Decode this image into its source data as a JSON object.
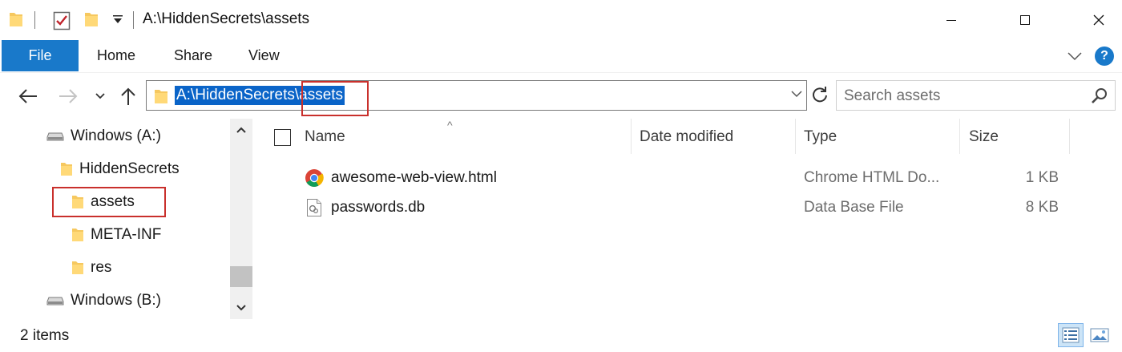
{
  "window": {
    "title": "A:\\HiddenSecrets\\assets",
    "minimize_glyph": "—",
    "maximize_glyph": "☐",
    "close_glyph": "✕"
  },
  "ribbon": {
    "file_label": "File",
    "tabs": [
      "Home",
      "Share",
      "View"
    ],
    "help_glyph": "?"
  },
  "address": {
    "path_prefix": "A:\\HiddenSecrets",
    "path_sep": "\\",
    "path_current": "assets"
  },
  "search": {
    "placeholder": "Search assets"
  },
  "nav_pane": {
    "items": [
      {
        "label": "Windows (A:)",
        "icon": "drive-icon"
      },
      {
        "label": "HiddenSecrets",
        "icon": "folder-icon"
      },
      {
        "label": "assets",
        "icon": "folder-icon"
      },
      {
        "label": "META-INF",
        "icon": "folder-icon"
      },
      {
        "label": "res",
        "icon": "folder-icon"
      },
      {
        "label": "Windows (B:)",
        "icon": "drive-icon"
      }
    ]
  },
  "file_list": {
    "columns": {
      "name": "Name",
      "date_modified": "Date modified",
      "type": "Type",
      "size": "Size"
    },
    "sort_indicator": "^",
    "files": [
      {
        "name": "awesome-web-view.html",
        "date_modified": "",
        "type": "Chrome HTML Do...",
        "size": "1 KB",
        "icon": "chrome-icon"
      },
      {
        "name": "passwords.db",
        "date_modified": "",
        "type": "Data Base File",
        "size": "8 KB",
        "icon": "database-file-icon"
      }
    ]
  },
  "status_bar": {
    "item_count": "2 items"
  },
  "colors": {
    "accent": "#1979ca",
    "selection": "#0a64c8",
    "highlight_box": "#c9302c",
    "folder": "#f6c85f"
  }
}
